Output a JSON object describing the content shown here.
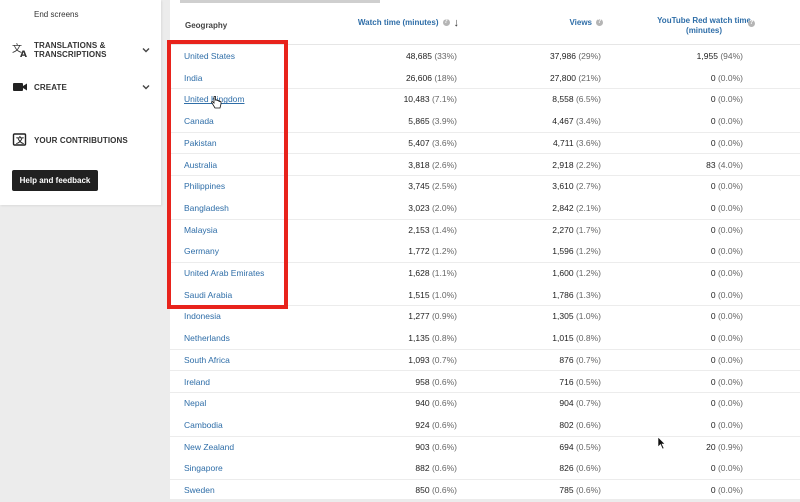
{
  "sidebar": {
    "end_screens": "End screens",
    "translations": "TRANSLATIONS & TRANSCRIPTIONS",
    "create": "CREATE",
    "contributions": "YOUR CONTRIBUTIONS",
    "help_button": "Help and feedback"
  },
  "table": {
    "headers": {
      "geography": "Geography",
      "watch_time": "Watch time (minutes)",
      "views": "Views",
      "red_watch_line1": "YouTube Red watch time",
      "red_watch_line2": "(minutes)"
    },
    "rows": [
      {
        "country": "United States",
        "watch": "48,685",
        "watch_pct": "(33%)",
        "views": "37,986",
        "views_pct": "(29%)",
        "red": "1,955",
        "red_pct": "(94%)"
      },
      {
        "country": "India",
        "watch": "26,606",
        "watch_pct": "(18%)",
        "views": "27,800",
        "views_pct": "(21%)",
        "red": "0",
        "red_pct": "(0.0%)"
      },
      {
        "country": "United Kingdom",
        "watch": "10,483",
        "watch_pct": "(7.1%)",
        "views": "8,558",
        "views_pct": "(6.5%)",
        "red": "0",
        "red_pct": "(0.0%)"
      },
      {
        "country": "Canada",
        "watch": "5,865",
        "watch_pct": "(3.9%)",
        "views": "4,467",
        "views_pct": "(3.4%)",
        "red": "0",
        "red_pct": "(0.0%)"
      },
      {
        "country": "Pakistan",
        "watch": "5,407",
        "watch_pct": "(3.6%)",
        "views": "4,711",
        "views_pct": "(3.6%)",
        "red": "0",
        "red_pct": "(0.0%)"
      },
      {
        "country": "Australia",
        "watch": "3,818",
        "watch_pct": "(2.6%)",
        "views": "2,918",
        "views_pct": "(2.2%)",
        "red": "83",
        "red_pct": "(4.0%)"
      },
      {
        "country": "Philippines",
        "watch": "3,745",
        "watch_pct": "(2.5%)",
        "views": "3,610",
        "views_pct": "(2.7%)",
        "red": "0",
        "red_pct": "(0.0%)"
      },
      {
        "country": "Bangladesh",
        "watch": "3,023",
        "watch_pct": "(2.0%)",
        "views": "2,842",
        "views_pct": "(2.1%)",
        "red": "0",
        "red_pct": "(0.0%)"
      },
      {
        "country": "Malaysia",
        "watch": "2,153",
        "watch_pct": "(1.4%)",
        "views": "2,270",
        "views_pct": "(1.7%)",
        "red": "0",
        "red_pct": "(0.0%)"
      },
      {
        "country": "Germany",
        "watch": "1,772",
        "watch_pct": "(1.2%)",
        "views": "1,596",
        "views_pct": "(1.2%)",
        "red": "0",
        "red_pct": "(0.0%)"
      },
      {
        "country": "United Arab Emirates",
        "watch": "1,628",
        "watch_pct": "(1.1%)",
        "views": "1,600",
        "views_pct": "(1.2%)",
        "red": "0",
        "red_pct": "(0.0%)"
      },
      {
        "country": "Saudi Arabia",
        "watch": "1,515",
        "watch_pct": "(1.0%)",
        "views": "1,786",
        "views_pct": "(1.3%)",
        "red": "0",
        "red_pct": "(0.0%)"
      },
      {
        "country": "Indonesia",
        "watch": "1,277",
        "watch_pct": "(0.9%)",
        "views": "1,305",
        "views_pct": "(1.0%)",
        "red": "0",
        "red_pct": "(0.0%)"
      },
      {
        "country": "Netherlands",
        "watch": "1,135",
        "watch_pct": "(0.8%)",
        "views": "1,015",
        "views_pct": "(0.8%)",
        "red": "0",
        "red_pct": "(0.0%)"
      },
      {
        "country": "South Africa",
        "watch": "1,093",
        "watch_pct": "(0.7%)",
        "views": "876",
        "views_pct": "(0.7%)",
        "red": "0",
        "red_pct": "(0.0%)"
      },
      {
        "country": "Ireland",
        "watch": "958",
        "watch_pct": "(0.6%)",
        "views": "716",
        "views_pct": "(0.5%)",
        "red": "0",
        "red_pct": "(0.0%)"
      },
      {
        "country": "Nepal",
        "watch": "940",
        "watch_pct": "(0.6%)",
        "views": "904",
        "views_pct": "(0.7%)",
        "red": "0",
        "red_pct": "(0.0%)"
      },
      {
        "country": "Cambodia",
        "watch": "924",
        "watch_pct": "(0.6%)",
        "views": "802",
        "views_pct": "(0.6%)",
        "red": "0",
        "red_pct": "(0.0%)"
      },
      {
        "country": "New Zealand",
        "watch": "903",
        "watch_pct": "(0.6%)",
        "views": "694",
        "views_pct": "(0.5%)",
        "red": "20",
        "red_pct": "(0.9%)"
      },
      {
        "country": "Singapore",
        "watch": "882",
        "watch_pct": "(0.6%)",
        "views": "826",
        "views_pct": "(0.6%)",
        "red": "0",
        "red_pct": "(0.0%)"
      },
      {
        "country": "Sweden",
        "watch": "850",
        "watch_pct": "(0.6%)",
        "views": "785",
        "views_pct": "(0.6%)",
        "red": "0",
        "red_pct": "(0.0%)"
      }
    ]
  },
  "colors": {
    "link": "#2f6ea8",
    "highlight": "#e8231c",
    "help_button_bg": "#212121"
  },
  "icons": {
    "translate": "translate-icon",
    "create": "video-camera-icon",
    "contributions": "contributions-icon",
    "chevron": "chevron-down-icon",
    "help": "help-circle-icon",
    "sort": "sort-down-arrow-icon"
  }
}
